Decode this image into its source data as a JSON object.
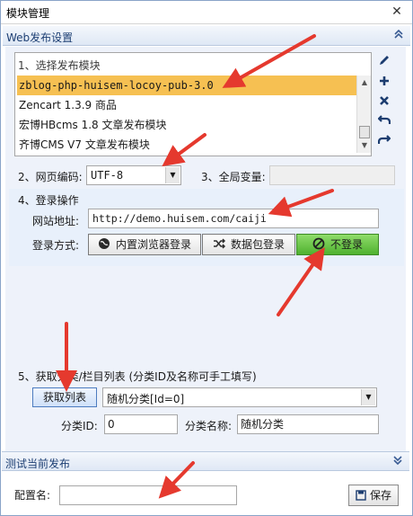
{
  "window": {
    "title": "模块管理",
    "close_glyph": "✕"
  },
  "web_group": {
    "title": "Web发布设置",
    "collapse_glyph": "⌃"
  },
  "module_section": {
    "title": "1、选择发布模块",
    "items": [
      "zblog-php-huisem-locoy-pub-3.0",
      "Zencart 1.3.9 商品",
      "宏博HBcms 1.8 文章发布模块",
      "齐博CMS V7 文章发布模块"
    ],
    "selected_index": 0
  },
  "toolbar": {
    "icons": [
      "pencil-icon",
      "plus-icon",
      "delete-icon",
      "undo-icon",
      "redo-icon"
    ]
  },
  "encoding": {
    "label": "2、网页编码:",
    "value": "UTF-8"
  },
  "global_var": {
    "label": "3、全局变量:",
    "value": ""
  },
  "login": {
    "title": "4、登录操作",
    "url_label": "网站地址:",
    "url_value": "http://demo.huisem.com/caiji",
    "method_label": "登录方式:",
    "btn_builtin": "内置浏览器登录",
    "btn_packet": "数据包登录",
    "btn_none": "不登录"
  },
  "fetch": {
    "title": "5、获取分类/栏目列表 (分类ID及名称可手工填写)",
    "button": "获取列表",
    "category_value": "随机分类[Id=0]",
    "id_label": "分类ID:",
    "id_value": "0",
    "name_label": "分类名称:",
    "name_value": "随机分类"
  },
  "test_group": {
    "title": "测试当前发布",
    "expand_glyph": "⌄"
  },
  "footer": {
    "config_label": "配置名:",
    "config_value": "",
    "save_button": "保存"
  },
  "colors": {
    "selection": "#f6c052",
    "arrow": "#e5392e",
    "group_header": "#dfe8f5",
    "no_login_green": "#5cbf3a"
  }
}
